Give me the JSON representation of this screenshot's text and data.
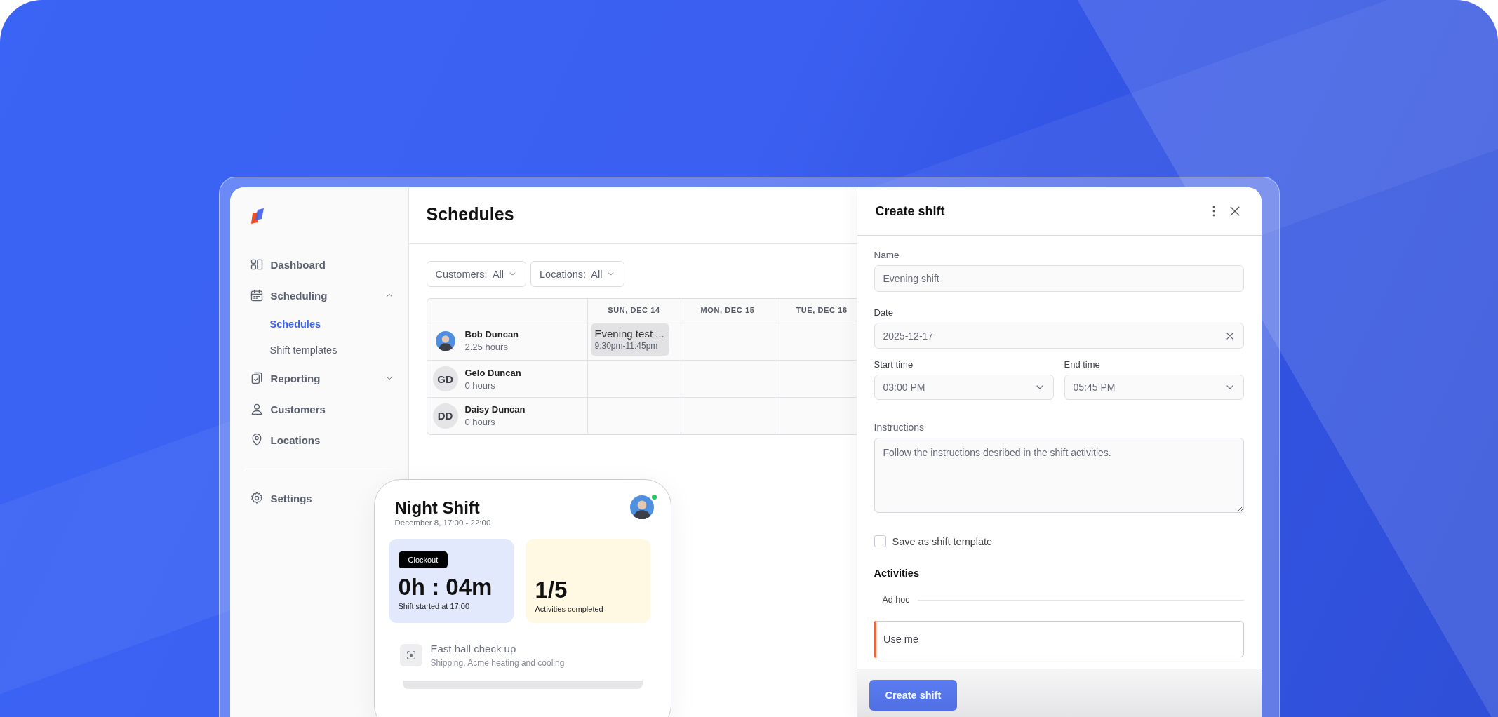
{
  "sidebar": {
    "items": [
      {
        "label": "Dashboard"
      },
      {
        "label": "Scheduling",
        "expanded": true,
        "children": [
          {
            "label": "Schedules",
            "selected": true
          },
          {
            "label": "Shift templates",
            "selected": false
          }
        ]
      },
      {
        "label": "Reporting",
        "expanded": false
      },
      {
        "label": "Customers"
      },
      {
        "label": "Locations"
      }
    ],
    "footer_items": [
      {
        "label": "Settings"
      }
    ]
  },
  "main": {
    "title": "Schedules",
    "filters": [
      {
        "label": "Customers:",
        "value": "All"
      },
      {
        "label": "Locations:",
        "value": "All"
      }
    ],
    "columns": [
      "SUN, DEC 14",
      "MON, DEC 15",
      "TUE, DEC 16"
    ],
    "rows": [
      {
        "name": "Bob Duncan",
        "hours": "2.25 hours",
        "avatar": {
          "kind": "photo"
        },
        "cells": [
          {
            "title": "Evening test ...",
            "time": "9:30pm-11:45pm"
          },
          null,
          null
        ]
      },
      {
        "name": "Gelo Duncan",
        "hours": "0 hours",
        "avatar": {
          "kind": "initials",
          "text": "GD"
        },
        "cells": [
          null,
          null,
          null
        ]
      },
      {
        "name": "Daisy Duncan",
        "hours": "0 hours",
        "avatar": {
          "kind": "initials",
          "text": "DD"
        },
        "cells": [
          null,
          null,
          null
        ]
      }
    ]
  },
  "shift_card": {
    "title": "Night Shift",
    "subtitle": "December 8, 17:00 - 22:00",
    "online": true,
    "clock": {
      "button": "Clockout",
      "value": "0h : 04m",
      "caption": "Shift started at 17:00"
    },
    "progress": {
      "value": "1/5",
      "caption": "Activities completed"
    },
    "activity": {
      "title": "East hall check up",
      "subtitle": "Shipping, Acme heating and cooling"
    }
  },
  "panel": {
    "title": "Create shift",
    "name": {
      "label": "Name",
      "value": "Evening shift"
    },
    "date": {
      "label": "Date",
      "value": "2025-12-17"
    },
    "start_time": {
      "label": "Start time",
      "value": "03:00 PM"
    },
    "end_time": {
      "label": "End time",
      "value": "05:45 PM"
    },
    "instructions": {
      "label": "Instructions",
      "value": "Follow the instructions desribed in the shift activities."
    },
    "template_checkbox": {
      "label": "Save as shift template",
      "checked": false
    },
    "activities": {
      "title": "Activities",
      "group": "Ad hoc",
      "items": [
        {
          "label": "Use me",
          "color": "#f0643c"
        }
      ]
    },
    "submit": "Create shift"
  }
}
